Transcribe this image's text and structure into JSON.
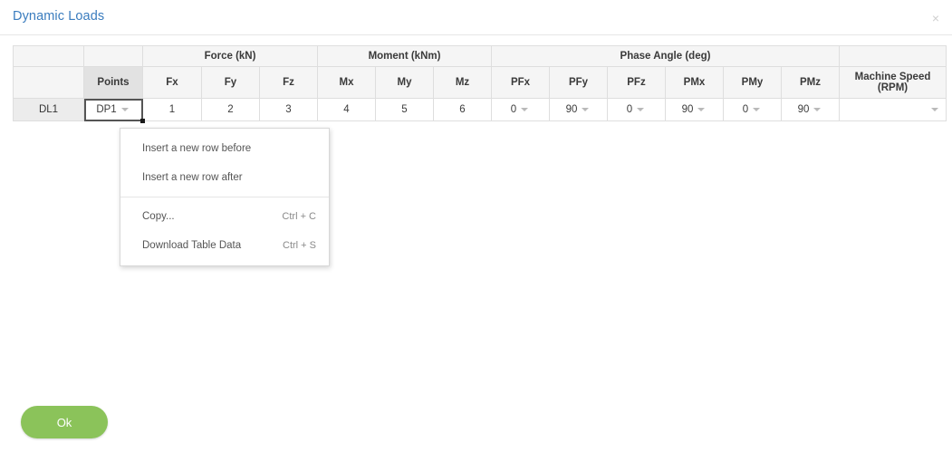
{
  "dialog": {
    "title": "Dynamic Loads",
    "close_icon": "close-icon",
    "close_glyph": "×",
    "ok_label": "Ok",
    "accent_color": "#3a7cbe",
    "ok_color": "#8bc35a"
  },
  "table": {
    "group_headers": [
      {
        "label": "",
        "span": 1
      },
      {
        "label": "",
        "span": 1
      },
      {
        "label": "Force (kN)",
        "span": 3
      },
      {
        "label": "Moment (kNm)",
        "span": 3
      },
      {
        "label": "Phase Angle (deg)",
        "span": 6
      },
      {
        "label": "",
        "span": 1
      }
    ],
    "columns": [
      {
        "label": "",
        "key": "rowhead"
      },
      {
        "label": "Points",
        "key": "points"
      },
      {
        "label": "Fx",
        "key": "fx"
      },
      {
        "label": "Fy",
        "key": "fy"
      },
      {
        "label": "Fz",
        "key": "fz"
      },
      {
        "label": "Mx",
        "key": "mx"
      },
      {
        "label": "My",
        "key": "my"
      },
      {
        "label": "Mz",
        "key": "mz"
      },
      {
        "label": "PFx",
        "key": "pfx"
      },
      {
        "label": "PFy",
        "key": "pfy"
      },
      {
        "label": "PFz",
        "key": "pfz"
      },
      {
        "label": "PMx",
        "key": "pmx"
      },
      {
        "label": "PMy",
        "key": "pmy"
      },
      {
        "label": "PMz",
        "key": "pmz"
      },
      {
        "label": "Machine Speed (RPM)",
        "key": "speed"
      }
    ],
    "rows": [
      {
        "rowhead": "DL1",
        "points": "DP1",
        "fx": "1",
        "fy": "2",
        "fz": "3",
        "mx": "4",
        "my": "5",
        "mz": "6",
        "pfx": "0",
        "pfy": "90",
        "pfz": "0",
        "pmx": "90",
        "pmy": "0",
        "pmz": "90",
        "speed": ""
      }
    ]
  },
  "context_menu": {
    "items": [
      {
        "label": "Insert a new row before",
        "shortcut": ""
      },
      {
        "label": "Insert a new row after",
        "shortcut": ""
      },
      {
        "label": "Copy...",
        "shortcut": "Ctrl + C"
      },
      {
        "label": "Download Table Data",
        "shortcut": "Ctrl + S"
      }
    ]
  }
}
